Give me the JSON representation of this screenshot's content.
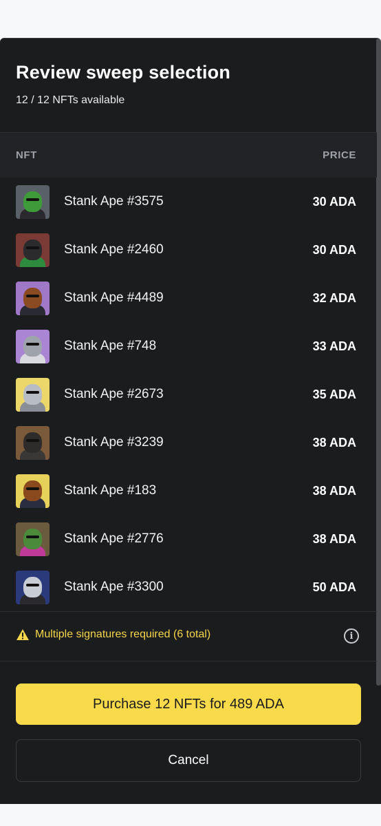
{
  "dialog": {
    "title": "Review sweep selection",
    "subtitle": "12 / 12 NFTs available"
  },
  "table": {
    "col_nft": "NFT",
    "col_price": "PRICE",
    "rows": [
      {
        "name": "Stank Ape #3575",
        "price": "30 ADA",
        "bg": "#5a6068",
        "fur": "#3f9a3a",
        "body": "#2a2a2e"
      },
      {
        "name": "Stank Ape #2460",
        "price": "30 ADA",
        "bg": "#7a3a35",
        "fur": "#2b2b2e",
        "body": "#2e8a3c"
      },
      {
        "name": "Stank Ape #4489",
        "price": "32 ADA",
        "bg": "#a078c8",
        "fur": "#8a4a22",
        "body": "#2a2a35"
      },
      {
        "name": "Stank Ape #748",
        "price": "33 ADA",
        "bg": "#a985d4",
        "fur": "#9fa3ab",
        "body": "#d8dadf"
      },
      {
        "name": "Stank Ape #2673",
        "price": "35 ADA",
        "bg": "#ecd86a",
        "fur": "#b8bcc4",
        "body": "#8a8e96"
      },
      {
        "name": "Stank Ape #3239",
        "price": "38 ADA",
        "bg": "#7a5a3a",
        "fur": "#2e2c2a",
        "body": "#3a3836"
      },
      {
        "name": "Stank Ape #183",
        "price": "38 ADA",
        "bg": "#e6d25a",
        "fur": "#8a4a1e",
        "body": "#2a2c40"
      },
      {
        "name": "Stank Ape #2776",
        "price": "38 ADA",
        "bg": "#6a5a3e",
        "fur": "#4a8a3a",
        "body": "#c03a9a"
      },
      {
        "name": "Stank Ape #3300",
        "price": "50 ADA",
        "bg": "#2a3a7a",
        "fur": "#c8ccd4",
        "body": "#2a2a2e"
      }
    ]
  },
  "notice": {
    "text": "Multiple signatures required (6 total)",
    "icon": "warning-icon",
    "color": "#f6d64a"
  },
  "buttons": {
    "purchase": "Purchase 12 NFTs for 489 ADA",
    "cancel": "Cancel"
  },
  "colors": {
    "accent": "#f9da4a",
    "background": "#1b1c1e"
  }
}
